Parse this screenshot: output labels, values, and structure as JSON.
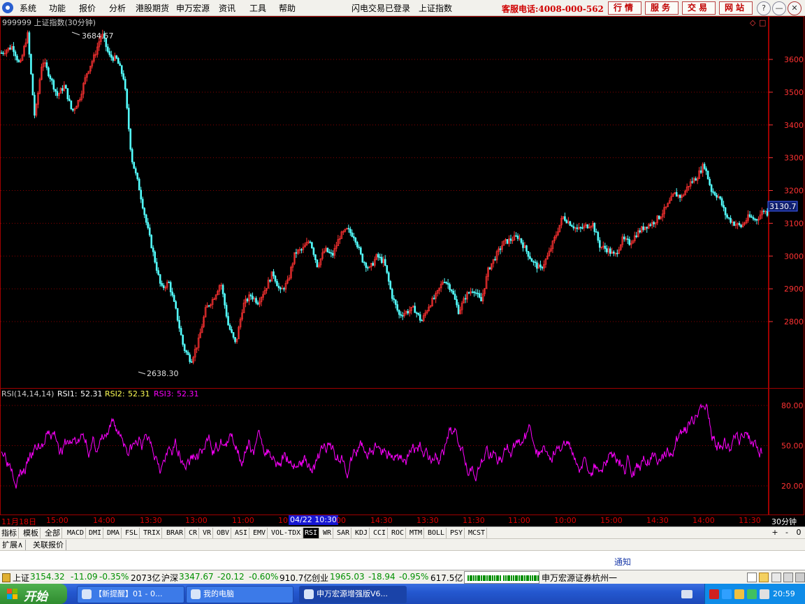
{
  "menu": {
    "items": [
      "系统",
      "功能",
      "报价",
      "分析",
      "港股期货",
      "申万宏源",
      "资讯",
      "工具",
      "帮助"
    ],
    "status_login": "闪电交易已登录",
    "status_index": "上证指数",
    "hotline": "客服电话:4008-000-562",
    "quick_buttons": [
      "行情",
      "服务",
      "交易",
      "网站"
    ]
  },
  "window_controls": {
    "help": "?",
    "minimize": "—",
    "restore": "❐",
    "close": "✕"
  },
  "chart": {
    "title": "999999 上证指数(30分钟)",
    "corner_icons": [
      "◇",
      "□"
    ],
    "high_label": "3684.57",
    "low_label": "2638.30",
    "price_ticks": [
      "3600",
      "3500",
      "3400",
      "3300",
      "3200",
      "3100",
      "3000",
      "2900",
      "2800"
    ],
    "current_price": "3130.7",
    "colors": {
      "up": "#ff3232",
      "down": "#54ffff",
      "grid": "#8b0000",
      "rsi": "#ff00ff",
      "axis_text": "#ff3232"
    },
    "rsi_header": {
      "name": "RSI(14,14,14)",
      "rsi1_label": "RSI1:",
      "rsi1_value": "52.31",
      "rsi2_label": "RSI2:",
      "rsi2_value": "52.31",
      "rsi3_label": "RSI3:",
      "rsi3_value": "52.31"
    },
    "rsi_ticks": [
      "80.00",
      "50.00",
      "20.00"
    ]
  },
  "chart_data": {
    "type": "candlestick",
    "title": "999999 上证指数(30分钟)",
    "price_range": [
      2600,
      3700
    ],
    "annotated_high": 3684.57,
    "annotated_low": 2638.3,
    "last_price": 3130.7,
    "price_path": [
      [
        0,
        3620
      ],
      [
        3,
        3640
      ],
      [
        5,
        3580
      ],
      [
        7,
        3680
      ],
      [
        9,
        3420
      ],
      [
        11,
        3600
      ],
      [
        13,
        3550
      ],
      [
        15,
        3490
      ],
      [
        17,
        3520
      ],
      [
        19,
        3440
      ],
      [
        21,
        3480
      ],
      [
        23,
        3560
      ],
      [
        25,
        3610
      ],
      [
        27,
        3680
      ],
      [
        29,
        3610
      ],
      [
        31,
        3600
      ],
      [
        33,
        3540
      ],
      [
        35,
        3300
      ],
      [
        37,
        3210
      ],
      [
        39,
        3100
      ],
      [
        41,
        3000
      ],
      [
        43,
        2900
      ],
      [
        45,
        2920
      ],
      [
        47,
        2830
      ],
      [
        49,
        2720
      ],
      [
        51,
        2680
      ],
      [
        53,
        2740
      ],
      [
        55,
        2840
      ],
      [
        57,
        2870
      ],
      [
        59,
        2920
      ],
      [
        61,
        2790
      ],
      [
        63,
        2730
      ],
      [
        65,
        2850
      ],
      [
        67,
        2880
      ],
      [
        69,
        2860
      ],
      [
        71,
        2900
      ],
      [
        73,
        2950
      ],
      [
        75,
        2890
      ],
      [
        77,
        2920
      ],
      [
        79,
        3010
      ],
      [
        81,
        3020
      ],
      [
        83,
        3050
      ],
      [
        85,
        2970
      ],
      [
        87,
        3020
      ],
      [
        89,
        3000
      ],
      [
        91,
        3060
      ],
      [
        93,
        3080
      ],
      [
        95,
        3060
      ],
      [
        97,
        2990
      ],
      [
        99,
        2960
      ],
      [
        101,
        3000
      ],
      [
        103,
        2980
      ],
      [
        105,
        2880
      ],
      [
        107,
        2820
      ],
      [
        109,
        2830
      ],
      [
        111,
        2840
      ],
      [
        113,
        2800
      ],
      [
        115,
        2850
      ],
      [
        117,
        2880
      ],
      [
        119,
        2930
      ],
      [
        121,
        2900
      ],
      [
        123,
        2830
      ],
      [
        125,
        2880
      ],
      [
        127,
        2900
      ],
      [
        129,
        2860
      ],
      [
        131,
        2960
      ],
      [
        133,
        3000
      ],
      [
        135,
        3040
      ],
      [
        137,
        3050
      ],
      [
        139,
        3060
      ],
      [
        141,
        3020
      ],
      [
        143,
        2980
      ],
      [
        145,
        2960
      ],
      [
        147,
        3000
      ],
      [
        149,
        3060
      ],
      [
        151,
        3120
      ],
      [
        153,
        3100
      ],
      [
        155,
        3080
      ],
      [
        157,
        3090
      ],
      [
        159,
        3100
      ],
      [
        161,
        3030
      ],
      [
        163,
        3020
      ],
      [
        165,
        3000
      ],
      [
        167,
        3050
      ],
      [
        169,
        3040
      ],
      [
        171,
        3070
      ],
      [
        173,
        3090
      ],
      [
        175,
        3100
      ],
      [
        177,
        3120
      ],
      [
        179,
        3150
      ],
      [
        181,
        3190
      ],
      [
        183,
        3180
      ],
      [
        185,
        3220
      ],
      [
        187,
        3240
      ],
      [
        189,
        3280
      ],
      [
        191,
        3200
      ],
      [
        193,
        3180
      ],
      [
        195,
        3120
      ],
      [
        197,
        3100
      ],
      [
        199,
        3090
      ],
      [
        201,
        3120
      ],
      [
        203,
        3110
      ],
      [
        205,
        3140
      ],
      [
        206,
        3131
      ]
    ],
    "rsi": {
      "params": [
        14,
        14,
        14
      ],
      "rsi1": 52.31,
      "rsi2": 52.31,
      "rsi3": 52.31,
      "ticks": [
        80,
        50,
        20
      ]
    },
    "x_labels": [
      "11月18日",
      "15:00",
      "14:00",
      "13:30",
      "13:00",
      "11:00",
      "10:30",
      "13:30",
      "11:30",
      "11:00",
      "10:00",
      "15:00",
      "14:30",
      "14:00",
      "11:30"
    ]
  },
  "time_axis": {
    "labels": [
      "11月18日",
      "15:00",
      "14:00",
      "13:30",
      "13:00",
      "11:00",
      "10",
      "00",
      "14:30",
      "13:30",
      "11:30",
      "11:00",
      "10:00",
      "15:00",
      "14:30",
      "14:00",
      "11:30"
    ],
    "cursor": "04/22 10:30",
    "period": "30分钟"
  },
  "indicator_tabs": {
    "cn": [
      "指标",
      "模板",
      "全部"
    ],
    "items": [
      "MACD",
      "DMI",
      "DMA",
      "FSL",
      "TRIX",
      "BRAR",
      "CR",
      "VR",
      "OBV",
      "ASI",
      "EMV",
      "VOL-TDX",
      "RSI",
      "WR",
      "SAR",
      "KDJ",
      "CCI",
      "ROC",
      "MTM",
      "BOLL",
      "PSY",
      "MCST"
    ],
    "active": "RSI",
    "controls": [
      "+",
      "-",
      "0"
    ]
  },
  "sub_tabs": [
    "扩展∧",
    "关联报价"
  ],
  "notice": "通知",
  "index_bar": {
    "sh_label": "上证",
    "sh_value": "3154.32",
    "sh_change": "-11.09",
    "sh_pct": "-0.35%",
    "sh_amount": "2073亿",
    "hs_label": "沪深",
    "hs_value": "3347.67",
    "hs_change": "-20.12",
    "hs_pct": "-0.60%",
    "hs_amount": "910.7亿",
    "cy_label": "创业",
    "cy_value": "1965.03",
    "cy_change": "-18.94",
    "cy_pct": "-0.95%",
    "cy_amount": "617.5亿",
    "broker": "申万宏源证券杭州一"
  },
  "taskbar": {
    "start": "开始",
    "tasks": [
      "【新提醒】01 - 0...",
      "我的电脑",
      "申万宏源增强版V6..."
    ],
    "clock": "20:59"
  }
}
